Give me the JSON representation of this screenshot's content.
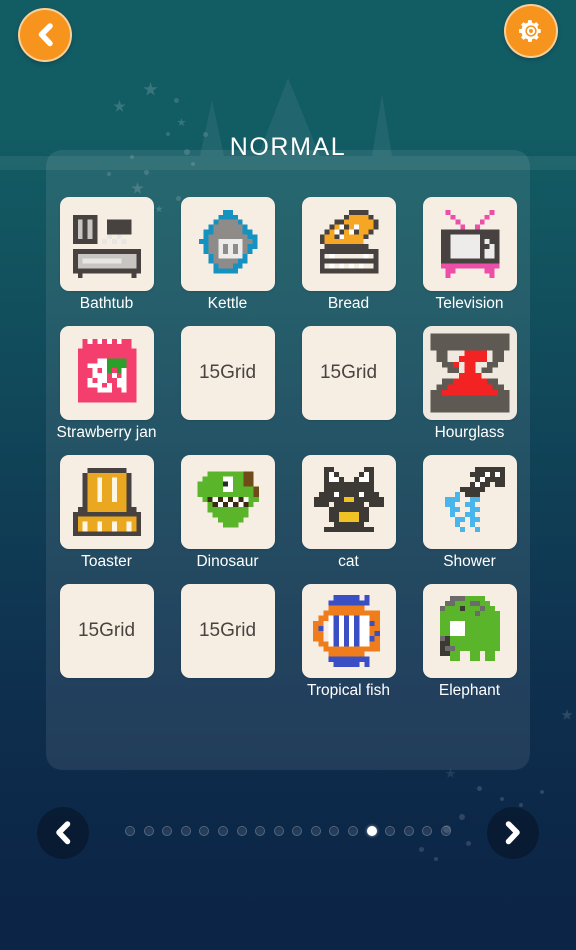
{
  "header": {
    "title": "NORMAL",
    "back_icon": "chevron-left-icon",
    "settings_icon": "gear-icon"
  },
  "grid": {
    "placeholder_label": "15Grid",
    "items": [
      {
        "label": "Bathtub",
        "icon": "bathtub-pixel-icon",
        "locked": false
      },
      {
        "label": "Kettle",
        "icon": "kettle-pixel-icon",
        "locked": false
      },
      {
        "label": "Bread",
        "icon": "bread-pixel-icon",
        "locked": false
      },
      {
        "label": "Television",
        "icon": "television-pixel-icon",
        "locked": false
      },
      {
        "label": "Strawberry jan",
        "icon": "strawberry-jam-pixel-icon",
        "locked": false
      },
      {
        "label": "",
        "icon": "locked-placeholder",
        "locked": true
      },
      {
        "label": "",
        "icon": "locked-placeholder",
        "locked": true
      },
      {
        "label": "Hourglass",
        "icon": "hourglass-pixel-icon",
        "locked": false
      },
      {
        "label": "Toaster",
        "icon": "toaster-pixel-icon",
        "locked": false
      },
      {
        "label": "Dinosaur",
        "icon": "dinosaur-pixel-icon",
        "locked": false
      },
      {
        "label": "cat",
        "icon": "cat-pixel-icon",
        "locked": false
      },
      {
        "label": "Shower",
        "icon": "shower-pixel-icon",
        "locked": false
      },
      {
        "label": "",
        "icon": "locked-placeholder",
        "locked": true
      },
      {
        "label": "",
        "icon": "locked-placeholder",
        "locked": true
      },
      {
        "label": "Tropical fish",
        "icon": "tropical-fish-pixel-icon",
        "locked": false
      },
      {
        "label": "Elephant",
        "icon": "elephant-pixel-icon",
        "locked": false
      }
    ]
  },
  "pagination": {
    "prev_icon": "chevron-left-icon",
    "next_icon": "chevron-right-icon",
    "total_pages": 18,
    "current_page": 14
  },
  "colors": {
    "accent_orange": "#f7941d",
    "tile_cream": "#f6eee3",
    "bg_top_teal": "#125c64",
    "bg_bottom_navy": "#0c2446",
    "label_white": "#ffffff"
  }
}
